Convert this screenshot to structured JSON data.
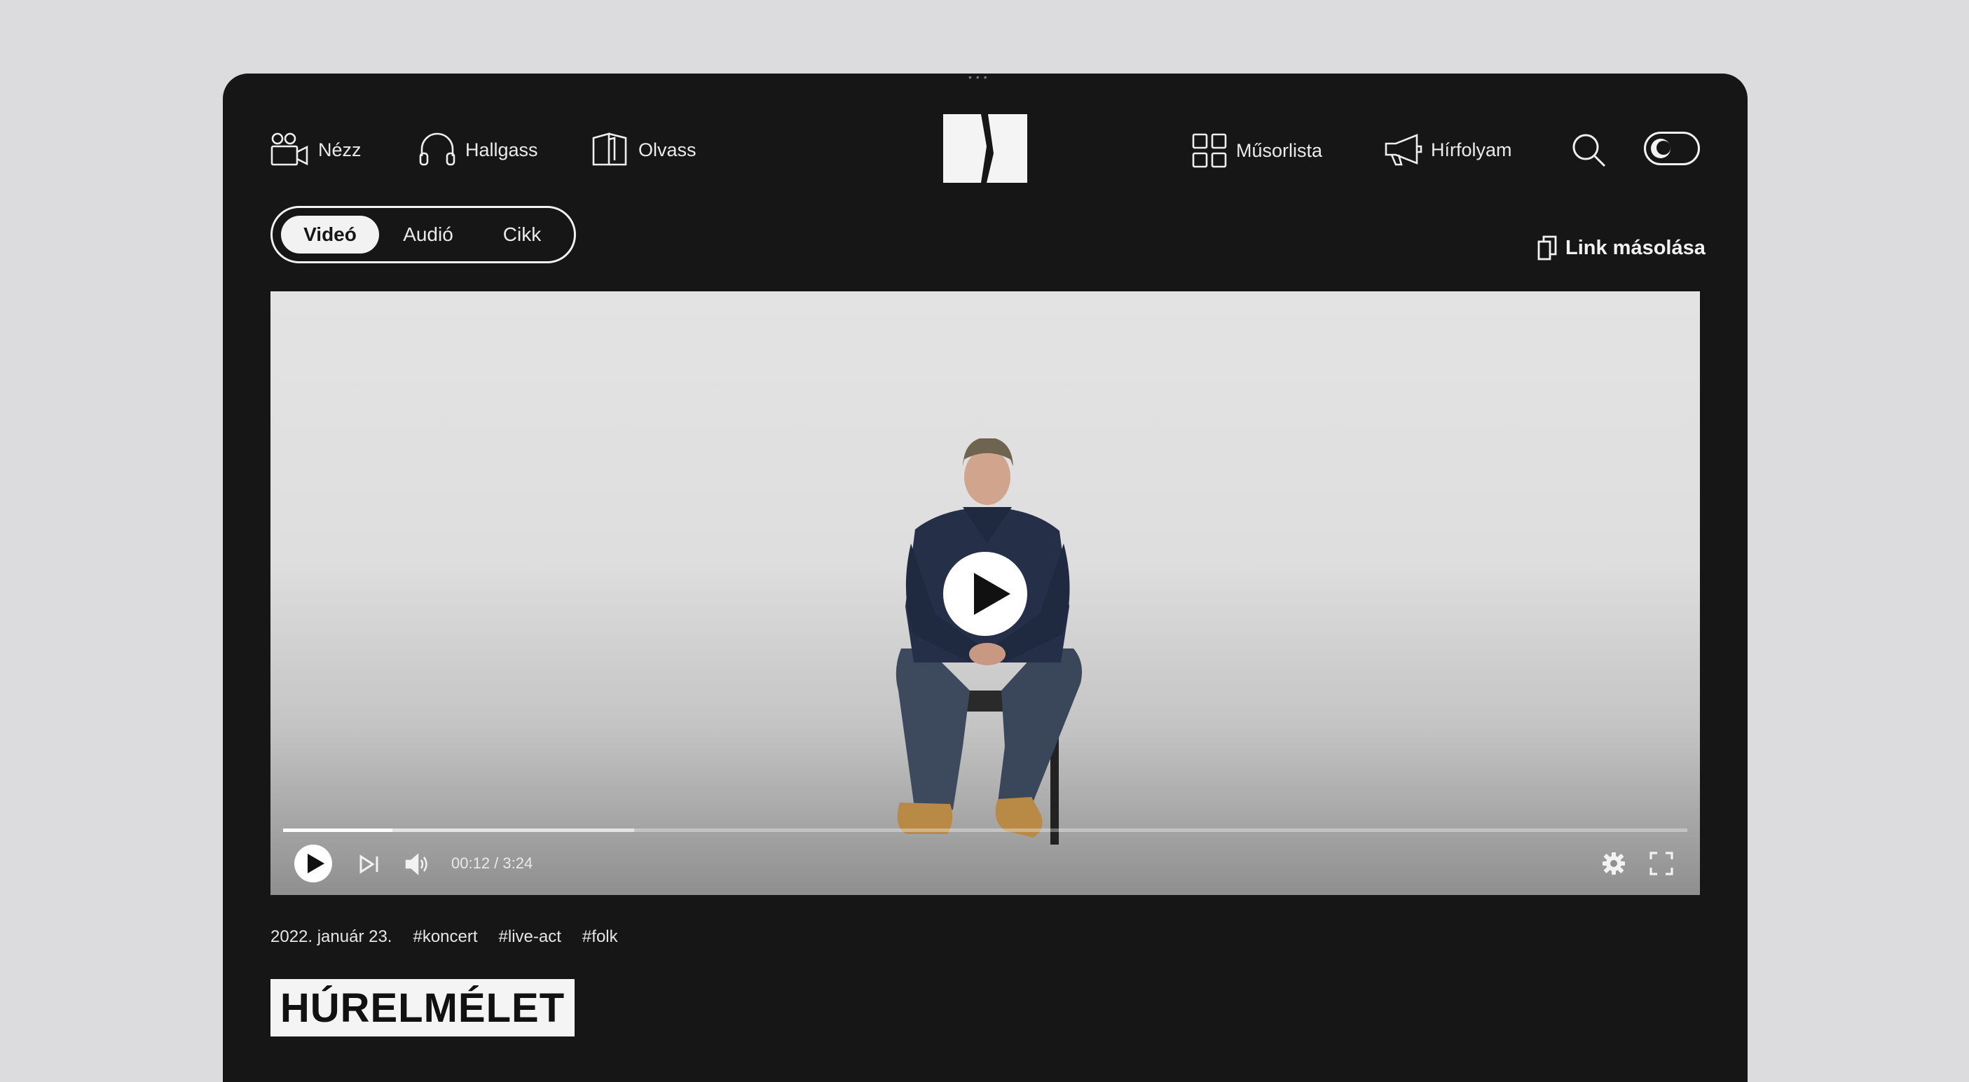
{
  "nav": {
    "watch_label": "Nézz",
    "listen_label": "Hallgass",
    "read_label": "Olvass",
    "programs_label": "Műsorlista",
    "feed_label": "Hírfolyam"
  },
  "tabs": [
    {
      "label": "Videó",
      "active": true
    },
    {
      "label": "Audió",
      "active": false
    },
    {
      "label": "Cikk",
      "active": false
    }
  ],
  "copy_link_label": "Link másolása",
  "player": {
    "time_current": "00:12",
    "time_total": "3:24",
    "time_display": "00:12 / 3:24",
    "progress": 0.078,
    "buffered": 0.25
  },
  "meta": {
    "date": "2022. január 23.",
    "tags": [
      "#koncert",
      "#live-act",
      "#folk"
    ]
  },
  "title": "HÚRELMÉLET",
  "colors": {
    "background": "#dcdcde",
    "frame": "#161616",
    "accent": "#f2f2f2"
  }
}
